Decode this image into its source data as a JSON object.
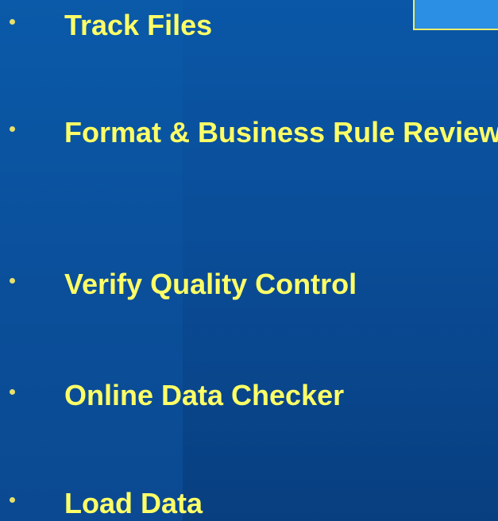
{
  "slide": {
    "colors": {
      "background": "#0a56a6",
      "bullet_text": "#ffff66",
      "bullet_marker": "#e7e06a",
      "callout_fill": "#2b8fe3",
      "callout_border": "#f2ee6a"
    },
    "bullets": [
      {
        "text": "Track Files"
      },
      {
        "text": "Format & Business Rule Review"
      },
      {
        "text": "Verify Quality Control"
      },
      {
        "text": "Online Data Checker"
      },
      {
        "text": "Load Data"
      }
    ]
  }
}
